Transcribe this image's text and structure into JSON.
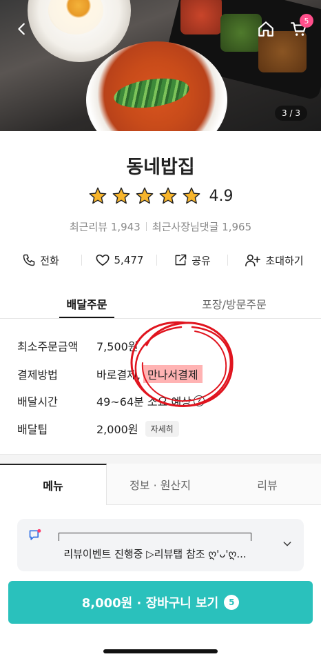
{
  "hero": {
    "page_indicator": "3 / 3",
    "cart_badge": "5",
    "icons": [
      "back-arrow-icon",
      "home-icon",
      "cart-icon"
    ]
  },
  "store": {
    "name": "동네밥집",
    "rating": "4.9",
    "stars": 5,
    "recent_reviews": "최근리뷰 1,943",
    "owner_replies": "최근사장님댓글 1,965"
  },
  "actions": [
    {
      "label": "전화",
      "icon": "phone-icon"
    },
    {
      "label": "5,477",
      "icon": "heart-icon"
    },
    {
      "label": "공유",
      "icon": "share-icon"
    },
    {
      "label": "초대하기",
      "icon": "invite-icon"
    }
  ],
  "order_tabs": {
    "delivery": "배달주문",
    "pickup": "포장/방문주문"
  },
  "info": {
    "min_order_label": "최소주문금액",
    "min_order_value": "7,500원",
    "payment_label": "결제방법",
    "payment_value": "바로결제,",
    "payment_highlight": "만나서결제",
    "delivery_time_label": "배달시간",
    "delivery_time_value": "49~64분 소요 예상",
    "delivery_time_help": "?",
    "tip_label": "배달팁",
    "tip_value": "2,000원",
    "tip_detail": "자세히"
  },
  "menu_tabs": {
    "menu": "메뉴",
    "info": "정보 · 원산지",
    "review": "리뷰"
  },
  "notice": {
    "text": "리뷰이벤트 진행중 ▷리뷰탭 참조 ღ'ᴗ'ღ...",
    "icon": "flag-icon"
  },
  "cart_button": {
    "label": "8,000원 · 장바구니 보기",
    "count": "5"
  },
  "colors": {
    "accent": "#2ac1bc",
    "highlight": "#ffb3b3",
    "annotation_red": "#e0141e",
    "badge": "#ff4f8b",
    "star": "#f7b52c"
  }
}
